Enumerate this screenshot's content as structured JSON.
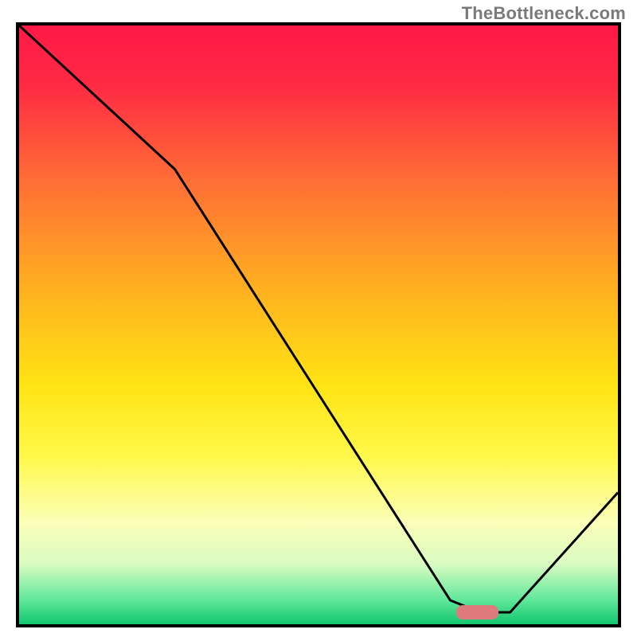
{
  "watermark": "TheBottleneck.com",
  "chart_data": {
    "type": "line",
    "title": "",
    "xlabel": "",
    "ylabel": "",
    "xlim": [
      0,
      100
    ],
    "ylim": [
      0,
      100
    ],
    "grid": false,
    "legend": false,
    "series": [
      {
        "name": "bottleneck-curve",
        "x": [
          0,
          26,
          72,
          77,
          82,
          100
        ],
        "values": [
          100,
          76,
          4,
          2,
          2,
          22
        ]
      }
    ],
    "marker": {
      "x_start": 73,
      "x_end": 80,
      "y": 2
    },
    "gradient_stops": [
      {
        "offset": 0,
        "color": "#ff1947"
      },
      {
        "offset": 10,
        "color": "#ff2a44"
      },
      {
        "offset": 25,
        "color": "#ff6a36"
      },
      {
        "offset": 45,
        "color": "#ffb41f"
      },
      {
        "offset": 60,
        "color": "#ffe314"
      },
      {
        "offset": 72,
        "color": "#fff84a"
      },
      {
        "offset": 83,
        "color": "#fcffb8"
      },
      {
        "offset": 90,
        "color": "#d8fbc1"
      },
      {
        "offset": 96,
        "color": "#5fe79a"
      },
      {
        "offset": 100,
        "color": "#12c66f"
      }
    ],
    "curve_color": "#000000",
    "marker_color": "#df7a7f"
  }
}
